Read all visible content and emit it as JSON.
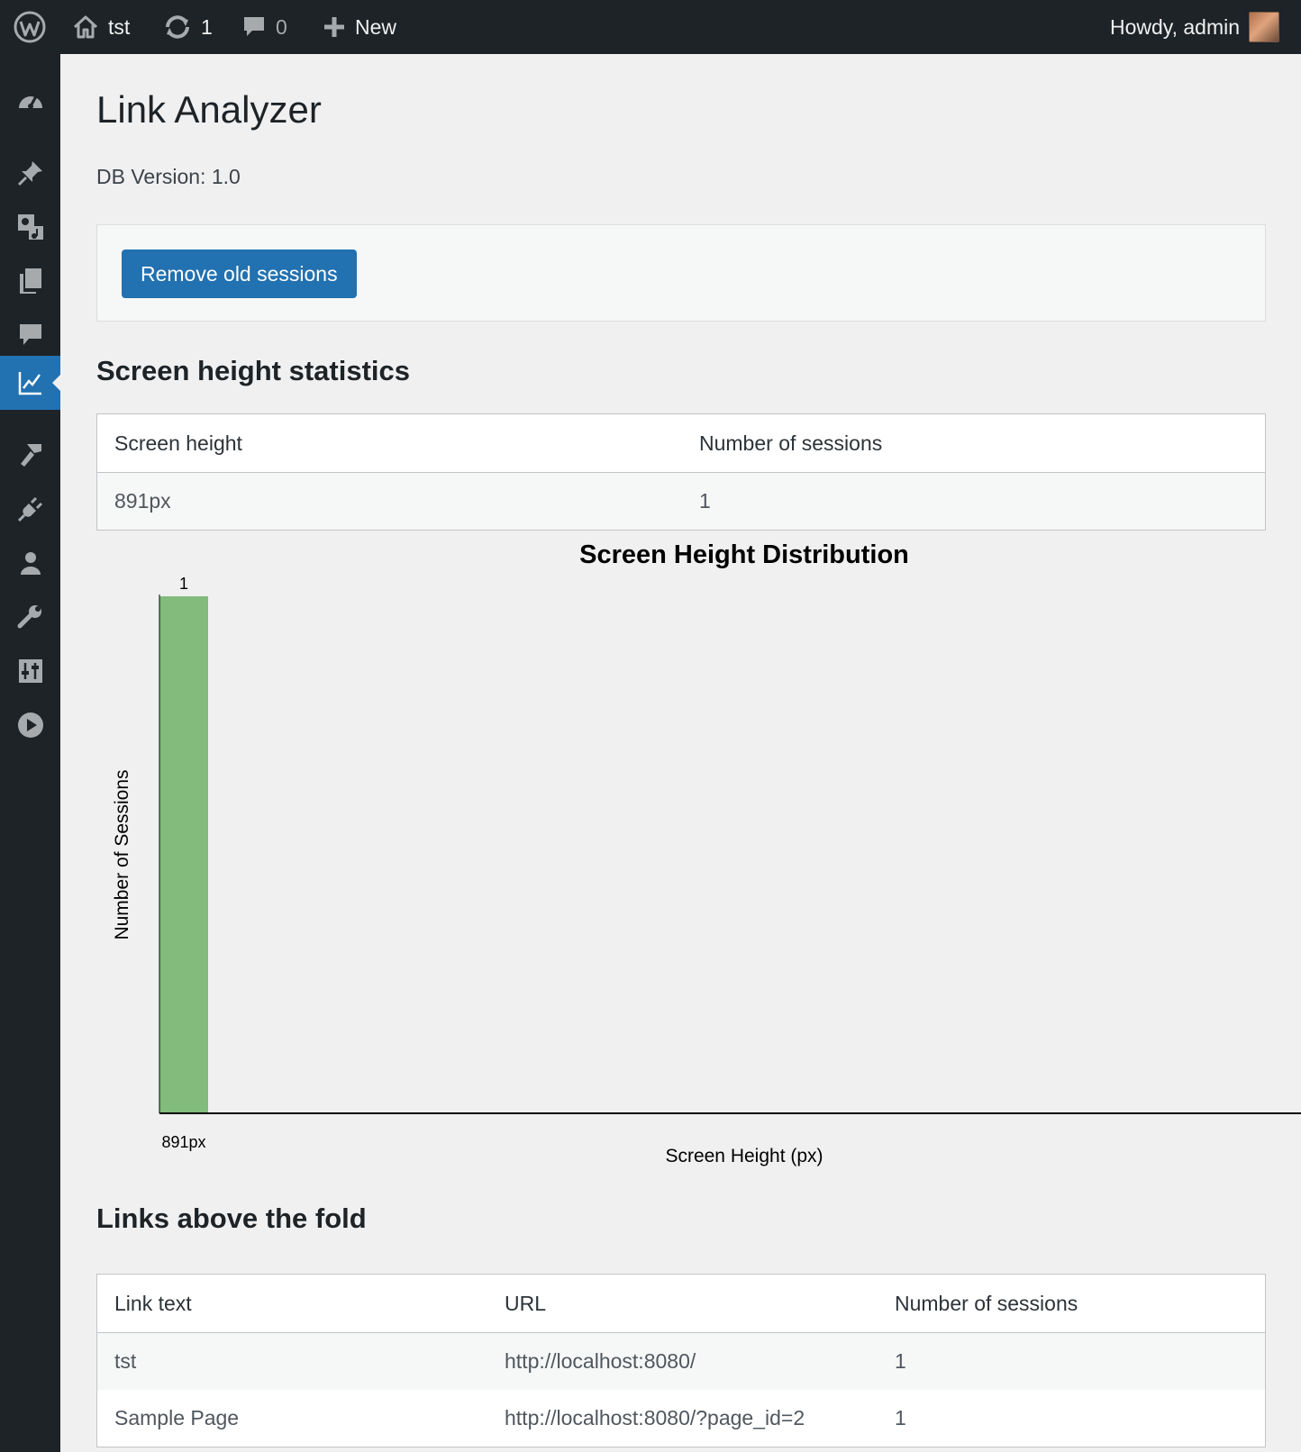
{
  "adminbar": {
    "site_name": "tst",
    "updates_count": "1",
    "comments_count": "0",
    "new_label": "New",
    "howdy": "Howdy, admin"
  },
  "sidebar": {
    "items": [
      {
        "name": "dashboard-icon",
        "active": false
      },
      {
        "name": "posts-icon",
        "active": false
      },
      {
        "name": "media-icon",
        "active": false
      },
      {
        "name": "pages-icon",
        "active": false
      },
      {
        "name": "comments-icon",
        "active": false
      },
      {
        "name": "analytics-icon",
        "active": true
      },
      {
        "name": "appearance-icon",
        "active": false
      },
      {
        "name": "plugins-icon",
        "active": false
      },
      {
        "name": "users-icon",
        "active": false
      },
      {
        "name": "tools-icon",
        "active": false
      },
      {
        "name": "settings-icon",
        "active": false
      },
      {
        "name": "play-icon",
        "active": false
      }
    ]
  },
  "page": {
    "title": "Link Analyzer",
    "db_version": "DB Version: 1.0",
    "remove_button": "Remove old sessions"
  },
  "screen_height_section": {
    "heading": "Screen height statistics",
    "columns": [
      "Screen height",
      "Number of sessions"
    ],
    "rows": [
      [
        "891px",
        "1"
      ]
    ]
  },
  "chart_data": {
    "type": "bar",
    "title": "Screen Height Distribution",
    "xlabel": "Screen Height (px)",
    "ylabel": "Number of Sessions",
    "categories": [
      "891px"
    ],
    "values": [
      1
    ],
    "data_labels": [
      "1"
    ],
    "ylim": [
      0,
      1
    ],
    "grid": false,
    "colors": {
      "bar": "#82bb7c",
      "axis": "#000000"
    }
  },
  "links_section": {
    "heading": "Links above the fold",
    "columns": [
      "Link text",
      "URL",
      "Number of sessions"
    ],
    "rows": [
      [
        "tst",
        "http://localhost:8080/",
        "1"
      ],
      [
        "Sample Page",
        "http://localhost:8080/?page_id=2",
        "1"
      ]
    ]
  },
  "colors": {
    "adminbar_bg": "#1d2327",
    "accent": "#2271b1",
    "page_bg": "#f0f0f1"
  }
}
